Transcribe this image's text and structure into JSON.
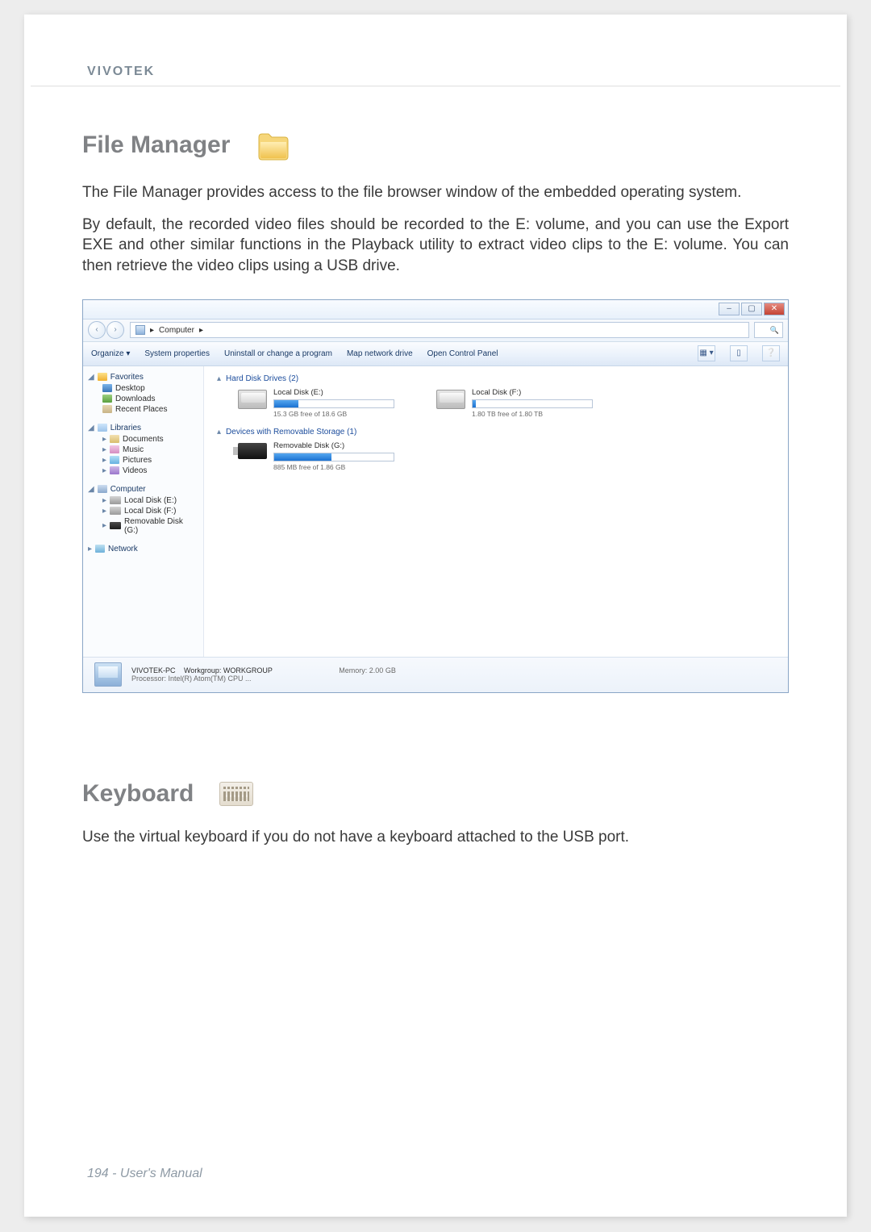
{
  "brand": "VIVOTEK",
  "sections": {
    "filemgr": {
      "heading": "File Manager",
      "p1": "The File Manager provides access to the file browser window of the embedded operating system.",
      "p2": "By default, the recorded video files should be recorded to the E: volume, and you can use the Export EXE and other similar functions in the Playback utility to extract video clips to the E: volume. You can then retrieve the video clips using a USB drive."
    },
    "keyboard": {
      "heading": "Keyboard",
      "p1": "Use the virtual keyboard if you do not have a keyboard attached to the USB port."
    }
  },
  "explorer": {
    "addr_computer": "Computer",
    "addr_sep": "▸",
    "search_placeholder": "",
    "toolbar": {
      "organize": "Organize ▾",
      "sysprops": "System properties",
      "uninstall": "Uninstall or change a program",
      "mapdrive": "Map network drive",
      "ctrlpanel": "Open Control Panel"
    },
    "sidebar": {
      "favorites": "Favorites",
      "desktop": "Desktop",
      "downloads": "Downloads",
      "recent": "Recent Places",
      "libraries": "Libraries",
      "documents": "Documents",
      "music": "Music",
      "pictures": "Pictures",
      "videos": "Videos",
      "computer": "Computer",
      "local_e": "Local Disk (E:)",
      "local_f": "Local Disk (F:)",
      "removable_g": "Removable Disk (G:)",
      "network": "Network"
    },
    "content": {
      "cat_hdd": "Hard Disk Drives (2)",
      "cat_removable": "Devices with Removable Storage (1)",
      "drive_e_label": "Local Disk (E:)",
      "drive_e_sub": "15.3 GB free of 18.6 GB",
      "drive_f_label": "Local Disk (F:)",
      "drive_f_sub": "1.80 TB free of 1.80 TB",
      "drive_g_label": "Removable Disk (G:)",
      "drive_g_sub": "885 MB free of 1.86 GB"
    },
    "details": {
      "pcname": "VIVOTEK-PC",
      "workgroup_label": "Workgroup:",
      "workgroup": "WORKGROUP",
      "memory_label": "Memory:",
      "memory": "2.00 GB",
      "processor_label": "Processor:",
      "processor": "Intel(R) Atom(TM) CPU ..."
    }
  },
  "footer": "194 - User's Manual"
}
